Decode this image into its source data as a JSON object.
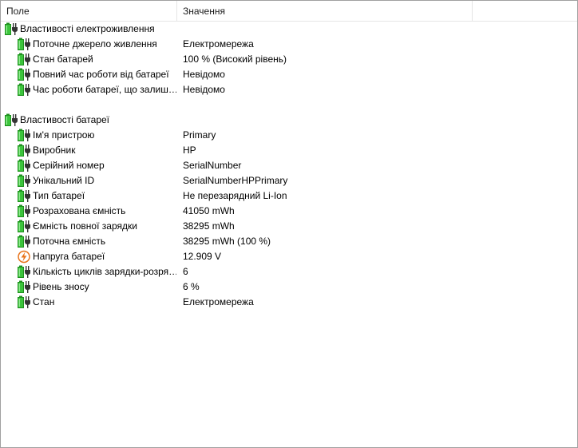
{
  "header": {
    "col_field": "Поле",
    "col_value": "Значення"
  },
  "groups": [
    {
      "label": "Властивості електроживлення",
      "icon": "battery-plug-icon",
      "rows": [
        {
          "field": "Поточне джерело живлення",
          "value": "Електромережа",
          "icon": "battery-plug-icon"
        },
        {
          "field": "Стан батарей",
          "value": "100 % (Високий рівень)",
          "icon": "battery-plug-icon"
        },
        {
          "field": "Повний час роботи від батареї",
          "value": "Невідомо",
          "icon": "battery-plug-icon"
        },
        {
          "field": "Час роботи батареї, що залиш…",
          "value": "Невідомо",
          "icon": "battery-plug-icon"
        }
      ]
    },
    {
      "label": "Властивості батареї",
      "icon": "battery-plug-icon",
      "rows": [
        {
          "field": "Ім'я пристрою",
          "value": "Primary",
          "icon": "battery-plug-icon"
        },
        {
          "field": "Виробник",
          "value": "HP",
          "icon": "battery-plug-icon"
        },
        {
          "field": "Серійний номер",
          "value": "SerialNumber",
          "icon": "battery-plug-icon"
        },
        {
          "field": "Унікальний ID",
          "value": "SerialNumberHPPrimary",
          "icon": "battery-plug-icon"
        },
        {
          "field": "Тип батареї",
          "value": "Не перезарядний Li-Ion",
          "icon": "battery-plug-icon"
        },
        {
          "field": "Розрахована ємність",
          "value": "41050 mWh",
          "icon": "battery-plug-icon"
        },
        {
          "field": "Ємність повної зарядки",
          "value": "38295 mWh",
          "icon": "battery-plug-icon"
        },
        {
          "field": "Поточна ємність",
          "value": "38295 mWh  (100 %)",
          "icon": "battery-plug-icon"
        },
        {
          "field": "Напруга батареї",
          "value": "12.909 V",
          "icon": "voltage-lightning-icon"
        },
        {
          "field": "Кількість циклів зарядки-розря…",
          "value": "6",
          "icon": "battery-plug-icon"
        },
        {
          "field": "Рівень зносу",
          "value": "6 %",
          "icon": "battery-plug-icon"
        },
        {
          "field": "Стан",
          "value": "Електромережа",
          "icon": "battery-plug-icon"
        }
      ]
    }
  ],
  "colors": {
    "battery_green": "#2fb52f",
    "voltage_orange": "#e8731a",
    "border": "#a0a0a0"
  }
}
